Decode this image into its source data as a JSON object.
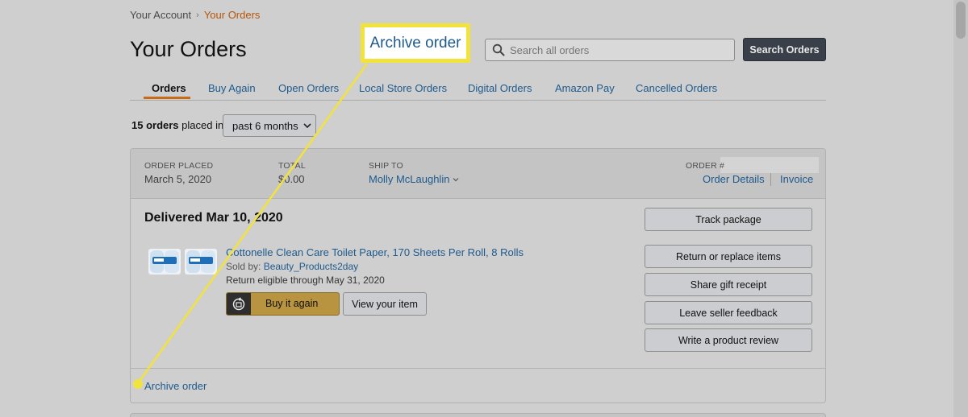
{
  "breadcrumb": {
    "parent": "Your Account",
    "separator": "›",
    "current": "Your Orders"
  },
  "header": {
    "title": "Your Orders"
  },
  "search": {
    "placeholder": "Search all orders",
    "button_label": "Search Orders"
  },
  "tabs": [
    {
      "label": "Orders",
      "active": true
    },
    {
      "label": "Buy Again"
    },
    {
      "label": "Open Orders"
    },
    {
      "label": "Local Store Orders"
    },
    {
      "label": "Digital Orders"
    },
    {
      "label": "Amazon Pay"
    },
    {
      "label": "Cancelled Orders"
    }
  ],
  "filter": {
    "count": "15 orders",
    "count_suffix": "placed in",
    "period": "past 6 months"
  },
  "order": {
    "placed_label": "ORDER PLACED",
    "placed_value": "March 5, 2020",
    "total_label": "TOTAL",
    "total_value": "$0.00",
    "ship_to_label": "SHIP TO",
    "ship_to_value": "Molly McLaughlin",
    "order_num_label": "ORDER #",
    "details_link": "Order Details",
    "invoice_link": "Invoice",
    "status": "Delivered Mar 10, 2020",
    "item": {
      "title": "Cottonelle Clean Care Toilet Paper, 170 Sheets Per Roll, 8 Rolls",
      "sold_by_label": "Sold by:",
      "seller": "Beauty_Products2day",
      "return_note": "Return eligible through May 31, 2020",
      "buy_again": "Buy it again",
      "view_item": "View your item"
    },
    "actions": [
      "Track package",
      "Return or replace items",
      "Share gift receipt",
      "Leave seller feedback",
      "Write a product review"
    ],
    "archive_link": "Archive order"
  },
  "callout": {
    "label": "Archive order",
    "color": "#f2e33c"
  },
  "colors": {
    "link": "#1d5a8e",
    "accent": "#c96a17",
    "buy_again": "#b89440"
  }
}
